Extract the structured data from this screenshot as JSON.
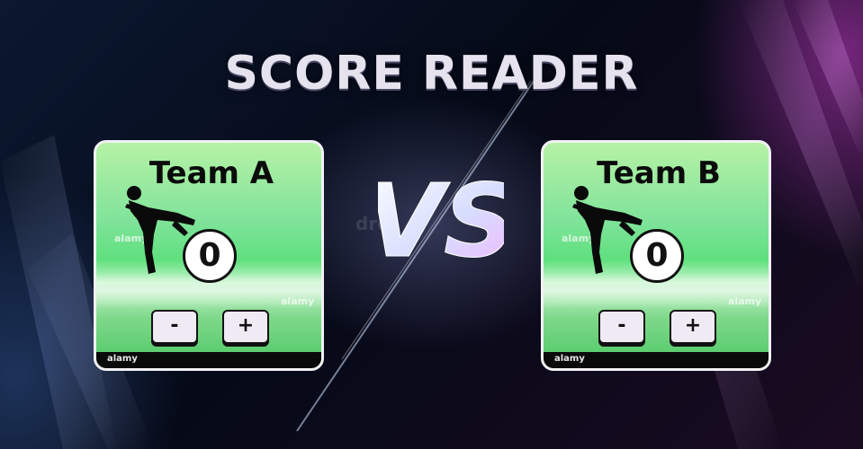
{
  "app": {
    "title": "SCORE READER"
  },
  "center": {
    "vs_text": "VS",
    "watermark": "dre"
  },
  "teams": [
    {
      "name": "Team A",
      "score": "0",
      "minus_label": "-",
      "plus_label": "+",
      "footer_text": "alamy"
    },
    {
      "name": "Team B",
      "score": "0",
      "minus_label": "-",
      "plus_label": "+",
      "footer_text": "alamy"
    }
  ],
  "image_marks": "alamy",
  "colors": {
    "card_green": "#5fe07e",
    "title": "#e6e3ef",
    "button": "#efeaf3",
    "accent_purple": "#c83cc8"
  }
}
